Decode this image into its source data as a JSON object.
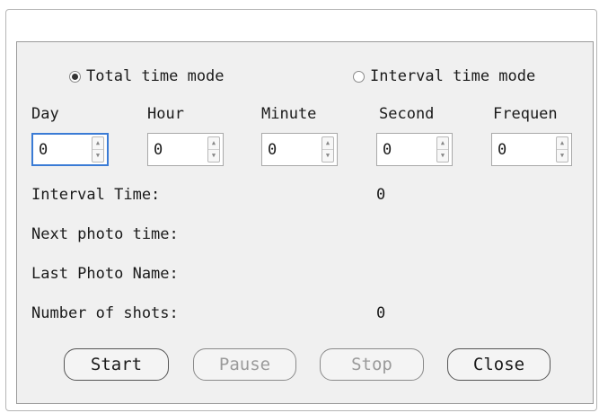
{
  "modes": {
    "total": {
      "label": "Total time mode",
      "selected": true
    },
    "interval": {
      "label": "Interval time mode",
      "selected": false
    }
  },
  "fields": [
    {
      "label": "Day",
      "value": "0"
    },
    {
      "label": "Hour",
      "value": "0"
    },
    {
      "label": "Minute",
      "value": "0"
    },
    {
      "label": "Second",
      "value": "0"
    },
    {
      "label": "Frequen",
      "value": "0"
    }
  ],
  "info": {
    "interval_time": {
      "label": "Interval Time:",
      "value": "0"
    },
    "next_photo_time": {
      "label": "Next photo time:",
      "value": ""
    },
    "last_photo_name": {
      "label": "Last Photo Name:",
      "value": ""
    },
    "number_of_shots": {
      "label": "Number of shots:",
      "value": "0"
    }
  },
  "buttons": {
    "start": "Start",
    "pause": "Pause",
    "stop": "Stop",
    "close": "Close"
  },
  "icons": {
    "spin_up": "up-arrow",
    "spin_down": "down-arrow"
  }
}
